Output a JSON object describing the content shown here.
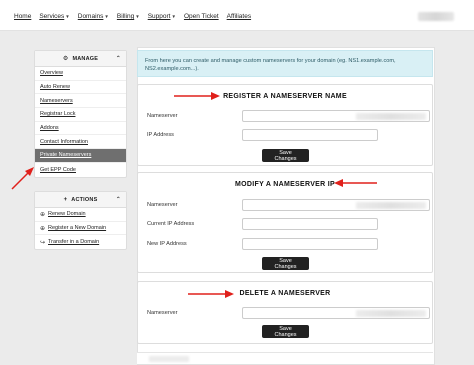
{
  "nav": {
    "items": [
      {
        "label": "Home",
        "caret": false
      },
      {
        "label": "Services",
        "caret": true
      },
      {
        "label": "Domains",
        "caret": true
      },
      {
        "label": "Billing",
        "caret": true
      },
      {
        "label": "Support",
        "caret": true
      },
      {
        "label": "Open Ticket",
        "caret": false
      },
      {
        "label": "Affiliates",
        "caret": false
      }
    ]
  },
  "manage": {
    "title": "MANAGE",
    "items": [
      {
        "label": "Overview"
      },
      {
        "label": "Auto Renew"
      },
      {
        "label": "Nameservers"
      },
      {
        "label": "Registrar Lock"
      },
      {
        "label": "Addons"
      },
      {
        "label": "Contact Information"
      },
      {
        "label": "Private Nameservers",
        "active": true
      },
      {
        "label": "Get EPP Code"
      }
    ]
  },
  "actions": {
    "title": "ACTIONS",
    "items": [
      {
        "label": "Renew Domain",
        "icon": "globe-icon"
      },
      {
        "label": "Register a New Domain",
        "icon": "globe-icon"
      },
      {
        "label": "Transfer in a Domain",
        "icon": "share-icon"
      }
    ]
  },
  "alert": {
    "text": "From here you can create and manage custom nameservers for your domain (eg. NS1.example.com, NS2.example.com...)."
  },
  "register": {
    "title": "REGISTER A NAMESERVER NAME",
    "nameserver_label": "Nameserver",
    "ip_label": "IP Address",
    "button": "Save Changes"
  },
  "modify": {
    "title": "MODIFY A NAMESERVER IP",
    "nameserver_label": "Nameserver",
    "current_ip_label": "Current IP Address",
    "new_ip_label": "New IP Address",
    "button": "Save Changes"
  },
  "delete": {
    "title": "DELETE A NAMESERVER",
    "nameserver_label": "Nameserver",
    "button": "Save Changes"
  },
  "colors": {
    "arrow": "#e0201b",
    "active_item": "#6f6f6f",
    "alert_bg": "#d9f0f5",
    "button": "#222222"
  }
}
